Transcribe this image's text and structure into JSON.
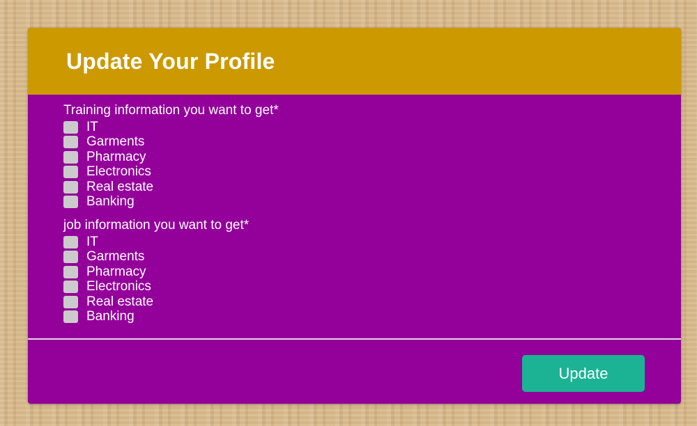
{
  "form": {
    "title": "Update Your Profile",
    "training": {
      "label": "Training information you want to get*",
      "options": [
        "IT",
        "Garments",
        "Pharmacy",
        "Electronics",
        "Real estate",
        "Banking"
      ]
    },
    "job": {
      "label": "job information you want to get*",
      "options": [
        "IT",
        "Garments",
        "Pharmacy",
        "Electronics",
        "Real estate",
        "Banking"
      ]
    },
    "submit_label": "Update"
  },
  "colors": {
    "header": "#cc9900",
    "panel": "#93009a",
    "button": "#1bb394",
    "checkbox": "#cbcbcb"
  }
}
